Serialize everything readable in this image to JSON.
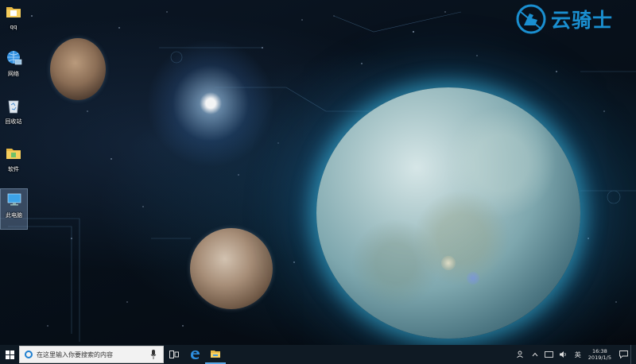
{
  "desktop": {
    "icons": [
      {
        "label": "qq",
        "icon": "folder-icon"
      },
      {
        "label": "网络",
        "icon": "network-icon"
      },
      {
        "label": "回收站",
        "icon": "recycle-bin-icon"
      },
      {
        "label": "软件",
        "icon": "folder-icon"
      },
      {
        "label": "此电脑",
        "icon": "computer-icon"
      }
    ]
  },
  "logo": {
    "text": "云骑士",
    "color": "#1a8fd0"
  },
  "taskbar": {
    "search": {
      "placeholder": "在这里输入你要搜索的内容"
    },
    "apps": [
      {
        "icon": "task-view-icon"
      },
      {
        "icon": "edge-icon"
      },
      {
        "icon": "file-explorer-icon"
      }
    ],
    "tray": {
      "icons": [
        "people-icon",
        "chevron-up-icon",
        "notification-icon",
        "volume-icon",
        "input-method-icon"
      ],
      "input_method_label": "英",
      "time": "16:38",
      "date": "2019/1/5"
    }
  },
  "colors": {
    "taskbar_bg": "#0f1a24",
    "accent": "#1e7fd0"
  }
}
